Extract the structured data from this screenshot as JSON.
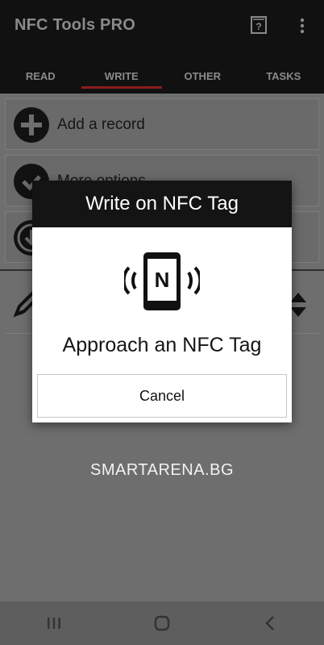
{
  "app": {
    "title": "NFC Tools PRO",
    "help_icon": "help-book-icon",
    "more_icon": "more-vertical-icon"
  },
  "tabs": [
    {
      "label": "READ",
      "active": false
    },
    {
      "label": "WRITE",
      "active": true
    },
    {
      "label": "OTHER",
      "active": false
    },
    {
      "label": "TASKS",
      "active": false
    }
  ],
  "list": {
    "items": [
      {
        "label": "Add a record",
        "icon": "plus-circle-icon"
      },
      {
        "label": "More options",
        "icon": "check-circle-icon"
      },
      {
        "label": "",
        "icon": "download-circle-icon"
      }
    ]
  },
  "dialog": {
    "title": "Write on NFC Tag",
    "message": "Approach an NFC Tag",
    "cancel_label": "Cancel",
    "icon": "nfc-phone-icon"
  },
  "watermark": "SMARTARENA.BG",
  "navbar": {
    "recents_icon": "recents-icon",
    "home_icon": "home-icon",
    "back_icon": "back-icon"
  },
  "colors": {
    "appbar": "#111111",
    "tab_indicator": "#8b1c1c",
    "scrim": "#6e6e6e",
    "dialog_header": "#141414"
  }
}
